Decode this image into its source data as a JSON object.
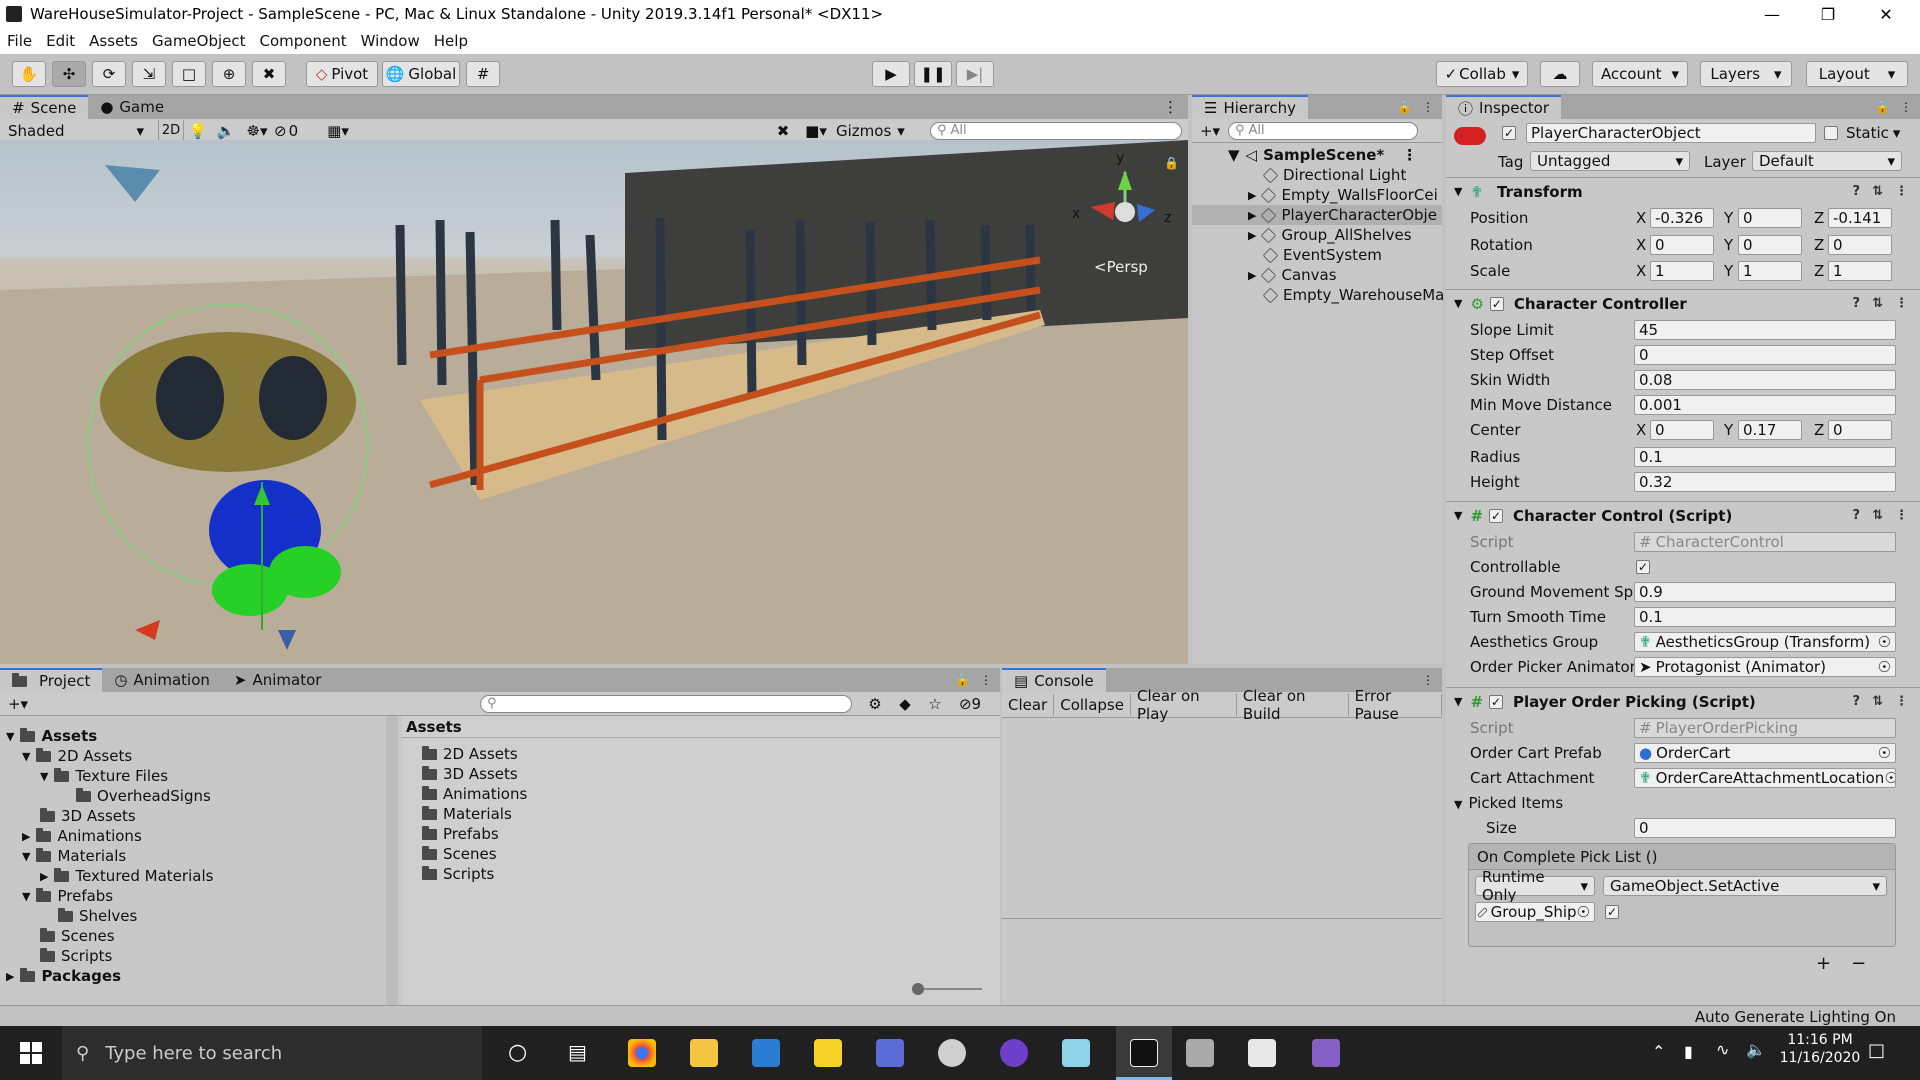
{
  "window": {
    "title": "WareHouseSimulator-Project - SampleScene - PC, Mac & Linux Standalone - Unity 2019.3.14f1 Personal* <DX11>"
  },
  "menu": [
    "File",
    "Edit",
    "Assets",
    "GameObject",
    "Component",
    "Window",
    "Help"
  ],
  "toolbar": {
    "pivot": "Pivot",
    "global": "Global",
    "collab": "Collab",
    "account": "Account",
    "layers": "Layers",
    "layout": "Layout"
  },
  "scene": {
    "tabs": [
      "Scene",
      "Game"
    ],
    "shading": "Shaded",
    "mode_2d": "2D",
    "hidden_count": "0",
    "gizmos": "Gizmos",
    "search_placeholder": "All",
    "persp_label": "Persp",
    "axis": {
      "x": "x",
      "y": "y",
      "z": "z"
    }
  },
  "hierarchy": {
    "tab": "Hierarchy",
    "search_placeholder": "All",
    "scene_name": "SampleScene*",
    "items": [
      "Directional Light",
      "Empty_WallsFloorCei",
      "PlayerCharacterObje",
      "Group_AllShelves",
      "EventSystem",
      "Canvas",
      "Empty_WarehouseMa"
    ]
  },
  "inspector": {
    "tab": "Inspector",
    "object_name": "PlayerCharacterObject",
    "static_label": "Static",
    "tag_label": "Tag",
    "tag_value": "Untagged",
    "layer_label": "Layer",
    "layer_value": "Default",
    "transform": {
      "title": "Transform",
      "position_label": "Position",
      "position": [
        "-0.326",
        "0",
        "-0.141"
      ],
      "rotation_label": "Rotation",
      "rotation": [
        "0",
        "0",
        "0"
      ],
      "scale_label": "Scale",
      "scale": [
        "1",
        "1",
        "1"
      ]
    },
    "character_controller": {
      "title": "Character Controller",
      "slope_limit_label": "Slope Limit",
      "slope_limit": "45",
      "step_offset_label": "Step Offset",
      "step_offset": "0",
      "skin_width_label": "Skin Width",
      "skin_width": "0.08",
      "min_move_label": "Min Move Distance",
      "min_move": "0.001",
      "center_label": "Center",
      "center": [
        "0",
        "0.17",
        "0"
      ],
      "radius_label": "Radius",
      "radius": "0.1",
      "height_label": "Height",
      "height": "0.32"
    },
    "character_control": {
      "title": "Character Control (Script)",
      "script_label": "Script",
      "script": "CharacterControl",
      "controllable_label": "Controllable",
      "ground_label": "Ground Movement Spe",
      "ground": "0.9",
      "turn_label": "Turn Smooth Time",
      "turn": "0.1",
      "aesthetics_label": "Aesthetics Group",
      "aesthetics": "AestheticsGroup (Transform)",
      "picker_label": "Order Picker Animator",
      "picker": "Protagonist (Animator)"
    },
    "player_order_picking": {
      "title": "Player Order Picking (Script)",
      "script_label": "Script",
      "script": "PlayerOrderPicking",
      "cart_prefab_label": "Order Cart Prefab",
      "cart_prefab": "OrderCart",
      "cart_attach_label": "Cart Attachment",
      "cart_attach": "OrderCareAttachmentLocation",
      "picked_label": "Picked Items",
      "size_label": "Size",
      "size": "0",
      "event_label": "On Complete Pick List ()",
      "runtime": "Runtime Only",
      "function": "GameObject.SetActive",
      "target": "Group_Ship",
      "plus": "+",
      "minus": "−"
    }
  },
  "project": {
    "tabs": [
      "Project",
      "Animation",
      "Animator"
    ],
    "tree": [
      {
        "label": "Assets",
        "depth": 0,
        "bold": true
      },
      {
        "label": "2D Assets",
        "depth": 1
      },
      {
        "label": "Texture Files",
        "depth": 2
      },
      {
        "label": "OverheadSigns",
        "depth": 3
      },
      {
        "label": "3D Assets",
        "depth": 1
      },
      {
        "label": "Animations",
        "depth": 1
      },
      {
        "label": "Materials",
        "depth": 1
      },
      {
        "label": "Textured Materials",
        "depth": 2
      },
      {
        "label": "Prefabs",
        "depth": 1
      },
      {
        "label": "Shelves",
        "depth": 2
      },
      {
        "label": "Scenes",
        "depth": 1
      },
      {
        "label": "Scripts",
        "depth": 1
      },
      {
        "label": "Packages",
        "depth": 0,
        "bold": true
      }
    ],
    "breadcrumb": "Assets",
    "folders": [
      "2D Assets",
      "3D Assets",
      "Animations",
      "Materials",
      "Prefabs",
      "Scenes",
      "Scripts"
    ],
    "hidden_count": "9"
  },
  "console": {
    "tab": "Console",
    "buttons": [
      "Clear",
      "Collapse",
      "Clear on Play",
      "Clear on Build",
      "Error Pause"
    ]
  },
  "statusbar": {
    "text": "Auto Generate Lighting On"
  },
  "taskbar": {
    "search": "Type here to search",
    "time": "11:16 PM",
    "date": "11/16/2020"
  }
}
